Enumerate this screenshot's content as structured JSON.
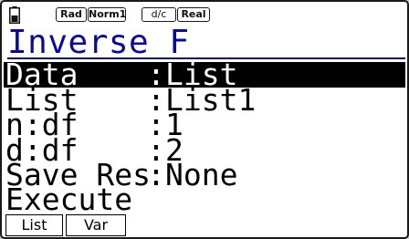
{
  "status": {
    "battery_icon": "battery-icon",
    "angle": "Rad",
    "display": "Norm1",
    "fraction": "d/c",
    "mode": "Real"
  },
  "title": "Inverse F",
  "rows": [
    {
      "label": "Data",
      "colon": ":",
      "value": "List",
      "selected": true
    },
    {
      "label": "List",
      "colon": ":",
      "value": "List1"
    },
    {
      "label": "n:df",
      "colon": ":",
      "value": "1"
    },
    {
      "label": "d:df",
      "colon": ":",
      "value": "2"
    },
    {
      "label": "Save Res",
      "colon": ":",
      "value": "None"
    },
    {
      "label": "Execute"
    }
  ],
  "function_keys": [
    "List",
    "Var"
  ],
  "colors": {
    "title": "#0a0a9a",
    "selection_bg": "#000000",
    "selection_fg": "#ffffff"
  }
}
